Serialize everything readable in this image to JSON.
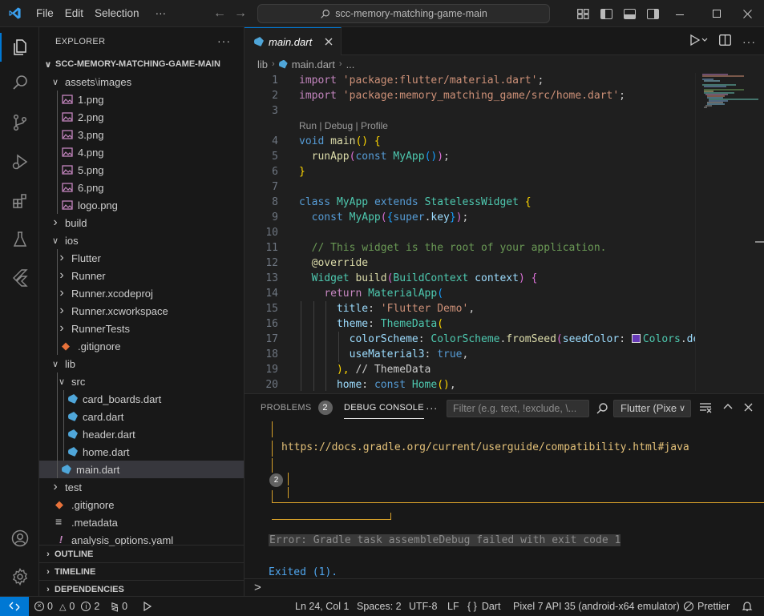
{
  "titlebar": {
    "menu": [
      "File",
      "Edit",
      "Selection",
      "···"
    ],
    "search_text": "scc-memory-matching-game-main"
  },
  "sidebar": {
    "title": "EXPLORER",
    "more": "···",
    "root": "SCC-MEMORY-MATCHING-GAME-MAIN",
    "tree": [
      {
        "label": "assets",
        "sublabel": "images",
        "type": "folder-open"
      },
      {
        "label": "1.png",
        "type": "image"
      },
      {
        "label": "2.png",
        "type": "image"
      },
      {
        "label": "3.png",
        "type": "image"
      },
      {
        "label": "4.png",
        "type": "image"
      },
      {
        "label": "5.png",
        "type": "image"
      },
      {
        "label": "6.png",
        "type": "image"
      },
      {
        "label": "logo.png",
        "type": "image"
      },
      {
        "label": "build",
        "type": "folder"
      },
      {
        "label": "ios",
        "type": "folder-open"
      },
      {
        "label": "Flutter",
        "type": "folder"
      },
      {
        "label": "Runner",
        "type": "folder"
      },
      {
        "label": "Runner.xcodeproj",
        "type": "folder"
      },
      {
        "label": "Runner.xcworkspace",
        "type": "folder"
      },
      {
        "label": "RunnerTests",
        "type": "folder"
      },
      {
        "label": ".gitignore",
        "type": "git"
      },
      {
        "label": "lib",
        "type": "folder-open"
      },
      {
        "label": "src",
        "type": "folder-open"
      },
      {
        "label": "card_boards.dart",
        "type": "dart"
      },
      {
        "label": "card.dart",
        "type": "dart"
      },
      {
        "label": "header.dart",
        "type": "dart"
      },
      {
        "label": "home.dart",
        "type": "dart"
      },
      {
        "label": "main.dart",
        "type": "dart"
      },
      {
        "label": "test",
        "type": "folder"
      },
      {
        "label": ".gitignore",
        "type": "git"
      },
      {
        "label": ".metadata",
        "type": "meta"
      },
      {
        "label": "analysis_options.yaml",
        "type": "yaml"
      }
    ],
    "sections": [
      "OUTLINE",
      "TIMELINE",
      "DEPENDENCIES"
    ]
  },
  "editor": {
    "tab_label": "main.dart",
    "breadcrumb": [
      "lib",
      "main.dart",
      "..."
    ],
    "codelens": "Run | Debug | Profile",
    "line_numbers": [
      "1",
      "2",
      "3",
      "4",
      "5",
      "6",
      "7",
      "8",
      "9",
      "10",
      "11",
      "12",
      "13",
      "14",
      "15",
      "16",
      "17",
      "18",
      "19",
      "20"
    ],
    "lines": {
      "l1": {
        "kw": "import",
        "str": "'package:flutter/material.dart'",
        "end": ";"
      },
      "l2": {
        "kw": "import",
        "str": "'package:memory_matching_game/src/home.dart'",
        "end": ";"
      },
      "l4": {
        "kw": "void",
        "fn": "main",
        "rest": "() {"
      },
      "l5": {
        "fn": "runApp",
        "kw": "const",
        "cls": "MyApp",
        "rest": "());"
      },
      "l6": {
        "rest": "}"
      },
      "l8": {
        "kw": "class",
        "cls": "MyApp",
        "kw2": "extends",
        "cls2": "StatelessWidget",
        "rest": "{"
      },
      "l9": {
        "kw": "const",
        "cls": "MyApp",
        "var": "super",
        "var2": "key",
        "rest": "});"
      },
      "l11": {
        "cm": "// This widget is the root of your application."
      },
      "l12": {
        "an": "@override"
      },
      "l13": {
        "cls": "Widget",
        "fn": "build",
        "cls2": "BuildContext",
        "var": "context",
        "rest": ") {"
      },
      "l14": {
        "kw": "return",
        "cls": "MaterialApp",
        "rest": "("
      },
      "l15": {
        "var": "title",
        "str": "'Flutter Demo'",
        "end": ","
      },
      "l16": {
        "var": "theme",
        "cls": "ThemeData",
        "rest": "("
      },
      "l17": {
        "var": "colorScheme",
        "cls": "ColorScheme",
        "fn": "fromSeed",
        "var2": "seedColor",
        "cls2": "Colors",
        "trunc": "de"
      },
      "l18": {
        "var": "useMaterial3",
        "kw": "true",
        "end": ","
      },
      "l19": {
        "rest": "),",
        "cm": "// ThemeData"
      },
      "l20": {
        "var": "home",
        "kw": "const",
        "cls": "Home",
        "rest": "(),"
      }
    }
  },
  "panel": {
    "tabs": {
      "problems": "PROBLEMS",
      "problems_count": "2",
      "debug_console": "DEBUG CONSOLE",
      "more": "···"
    },
    "filter_placeholder": "Filter (e.g. text, !exclude, \\...",
    "session_select": "Flutter (Pixe",
    "output": {
      "link": "https://docs.gradle.org/current/userguide/compatibility.html#java",
      "repeat_badge": "2",
      "error": "Error: Gradle task assembleDebug failed with exit code 1",
      "exited": "Exited (1)."
    },
    "prompt": ">"
  },
  "statusbar": {
    "errors": "0",
    "warnings": "0",
    "info": "2",
    "ports": "0",
    "position": "Ln 24, Col 1",
    "spaces": "Spaces: 2",
    "encoding": "UTF-8",
    "eol": "LF",
    "language": "Dart",
    "language_braces": "{ }",
    "device": "Pixel 7 API 35 (android-x64 emulator)",
    "prettier": "Prettier"
  },
  "colors": {
    "accent": "#0078d4",
    "dart": "#4fa6d9",
    "error_text": "#8b8b8b",
    "gradle_border": "#d7a02a"
  }
}
